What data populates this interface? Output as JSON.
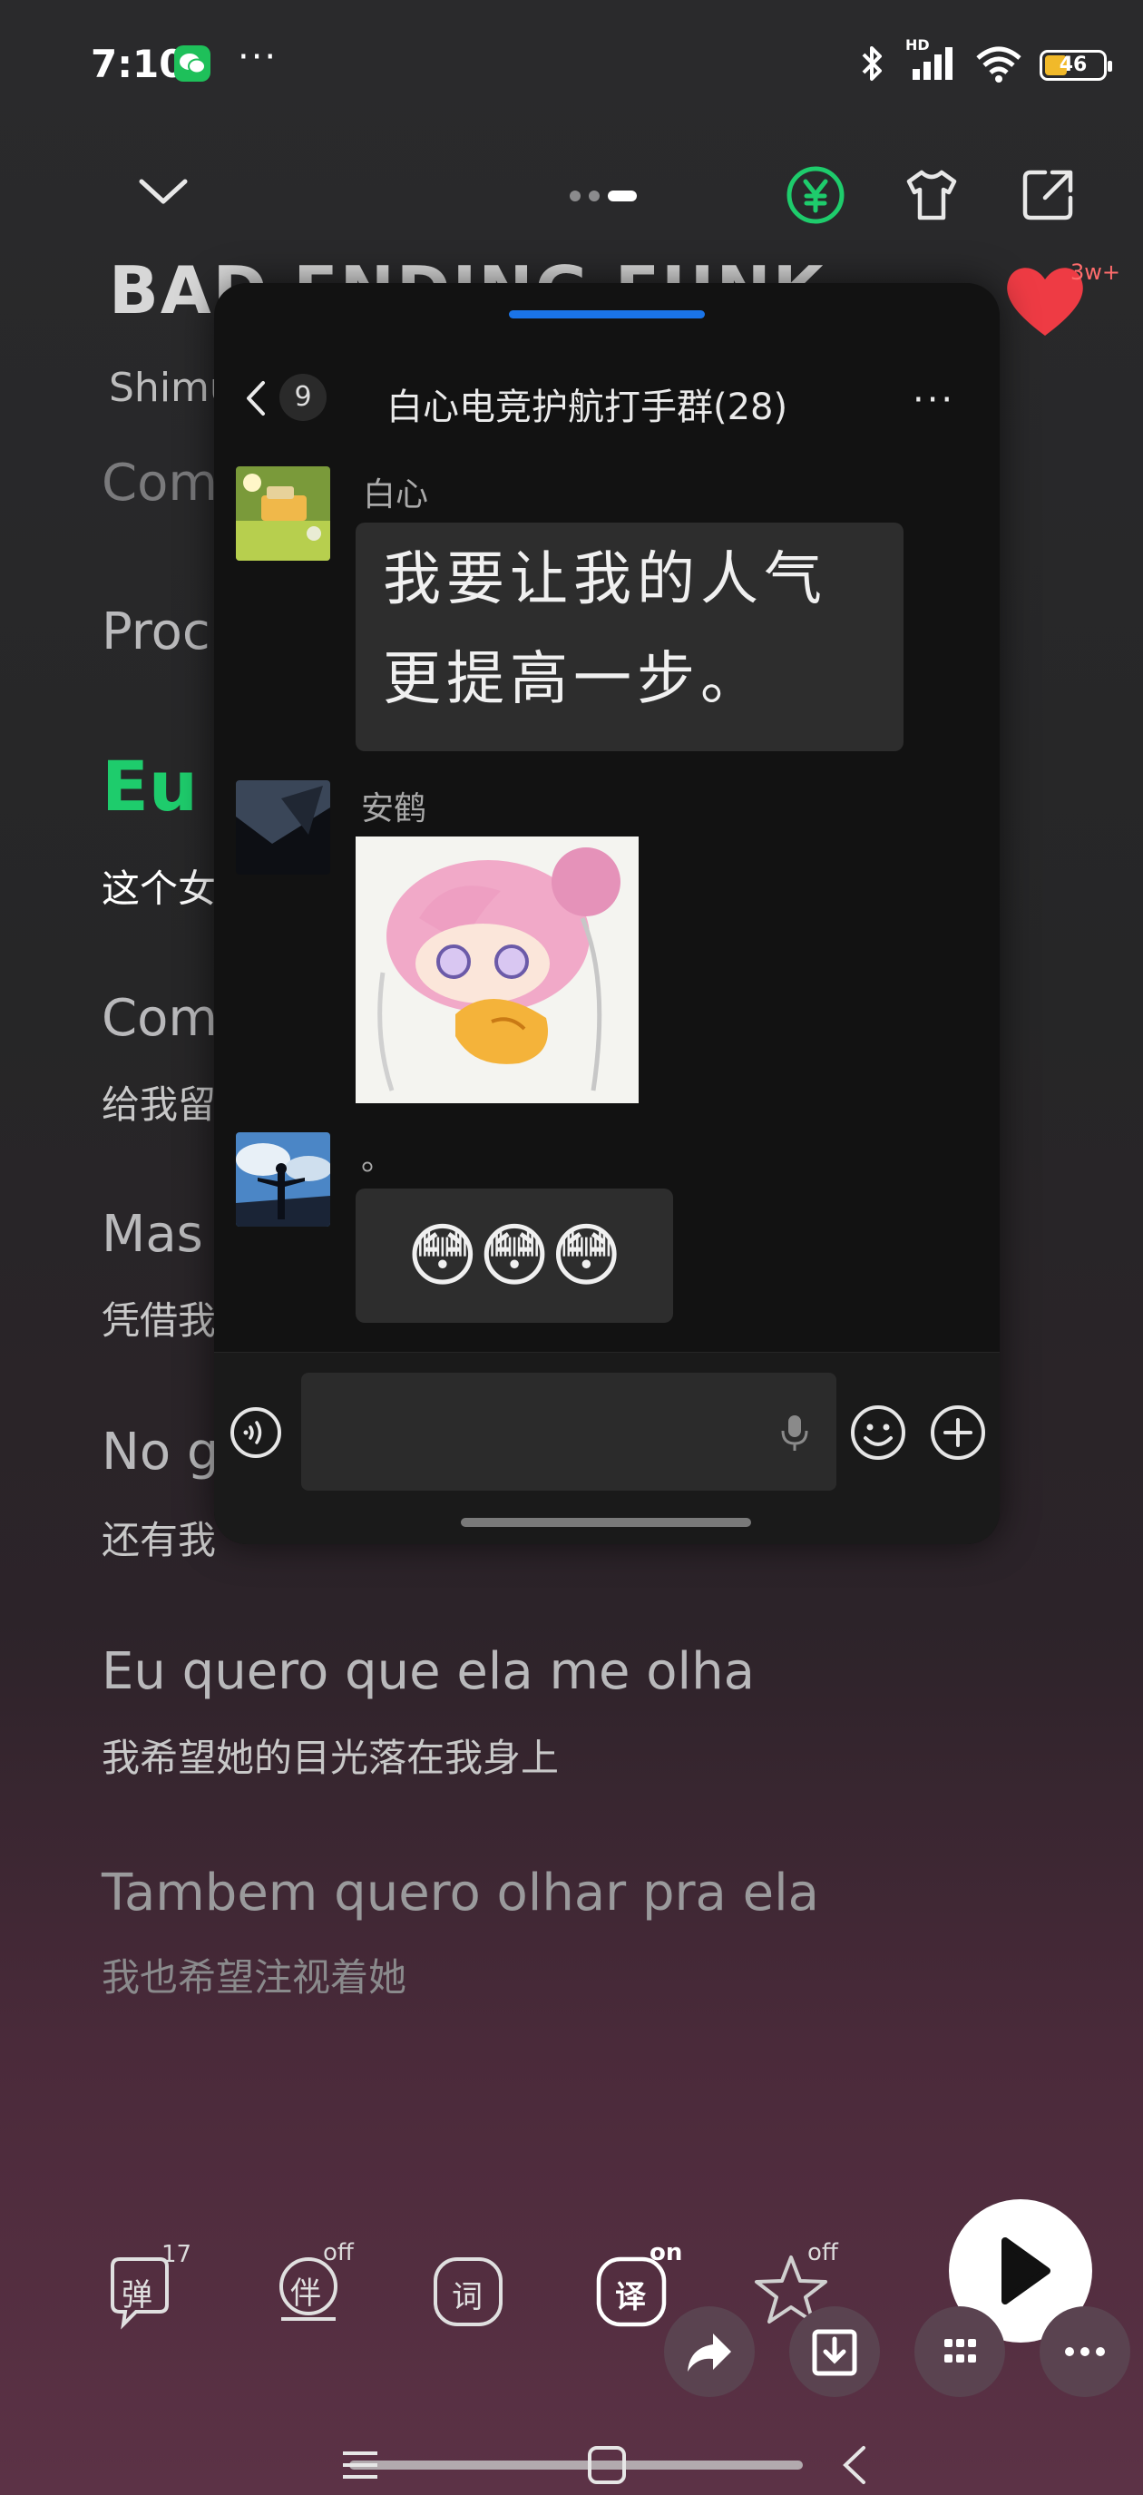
{
  "status_bar": {
    "time": "7:10",
    "dots": "···",
    "network": "HD",
    "battery": "46",
    "colors": {
      "wechat": "#1ec05a",
      "battery_fill": "#f1b92a"
    }
  },
  "player": {
    "song_title": "BAD ENDING FUNK",
    "artist": "Shimu",
    "like_count": "3w+",
    "accent_color": "#1ecc6c",
    "header_icons": [
      "chevron-down-icon",
      "yen-coin-icon",
      "tshirt-icon",
      "share-icon"
    ]
  },
  "lyrics": [
    {
      "text": "Com",
      "sub": ""
    },
    {
      "text": "Proc",
      "sub": ""
    },
    {
      "text": "Eu",
      "sub": "这个女"
    },
    {
      "text": "Com",
      "sub": "给我留"
    },
    {
      "text": "Mas",
      "sub": "凭借我"
    },
    {
      "text": "No g",
      "sub": "还有我"
    },
    {
      "text": "Eu quero que ela me olha",
      "sub": "我希望她的目光落在我身上"
    },
    {
      "text": "Tambem quero olhar pra ela",
      "sub": "我也希望注视着她"
    }
  ],
  "controls": {
    "danmaku": {
      "label": "弹",
      "badge": "17"
    },
    "accompany": {
      "label": "伴",
      "badge": "off"
    },
    "lyrics_word": {
      "label": "词"
    },
    "translate": {
      "label": "译",
      "badge": "on"
    },
    "favorite": {
      "badge": "off"
    }
  },
  "chat": {
    "unread": "9",
    "title": "白心电竞护航打手群(28)",
    "more": "···",
    "messages": [
      {
        "sender": "白心",
        "type": "text",
        "lines": [
          "我要让我的人气",
          "更提高一步。"
        ]
      },
      {
        "sender": "安鹤",
        "type": "sticker",
        "sticker": "anime-girl-sticker"
      },
      {
        "sender": "。",
        "type": "emoji",
        "emoji": "😳😳😳"
      }
    ]
  }
}
